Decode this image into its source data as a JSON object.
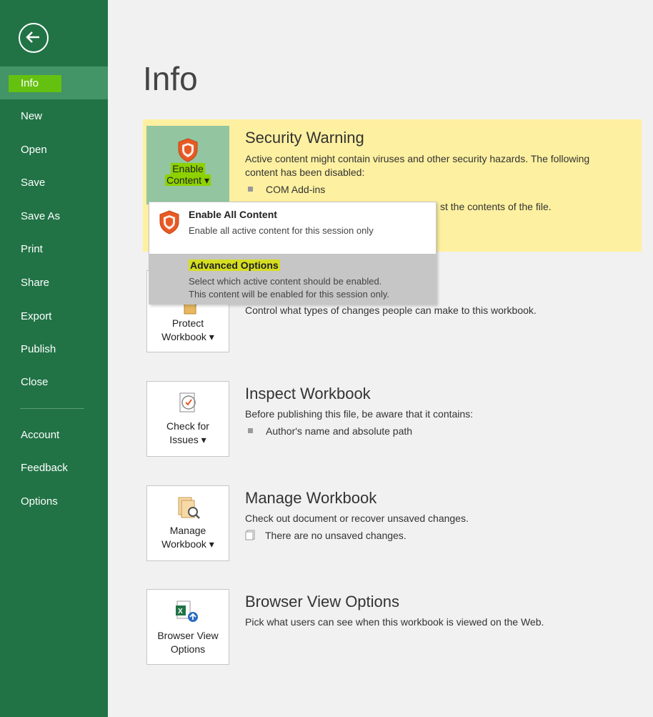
{
  "sidebar": {
    "items": [
      {
        "label": "Info"
      },
      {
        "label": "New"
      },
      {
        "label": "Open"
      },
      {
        "label": "Save"
      },
      {
        "label": "Save As"
      },
      {
        "label": "Print"
      },
      {
        "label": "Share"
      },
      {
        "label": "Export"
      },
      {
        "label": "Publish"
      },
      {
        "label": "Close"
      },
      {
        "label": "Account"
      },
      {
        "label": "Feedback"
      },
      {
        "label": "Options"
      }
    ]
  },
  "page": {
    "title": "Info"
  },
  "security": {
    "button_line1": "Enable",
    "button_line2": "Content",
    "title": "Security Warning",
    "desc1": "Active content might contain viruses and other security hazards. The following",
    "desc2": "content has been disabled:",
    "bullet": "COM Add-ins",
    "trust_text": "st the contents of the file."
  },
  "dropdown": {
    "enable_all_title": "Enable All Content",
    "enable_all_desc": "Enable all active content for this session only",
    "advanced_title": "Advanced Options",
    "advanced_desc1": "Select which active content should be enabled.",
    "advanced_desc2": "This content will be enabled for this session only."
  },
  "protect": {
    "button_line1": "Protect",
    "button_line2": "Workbook",
    "desc": "Control what types of changes people can make to this workbook."
  },
  "inspect": {
    "button_line1": "Check for",
    "button_line2": "Issues",
    "title": "Inspect Workbook",
    "desc": "Before publishing this file, be aware that it contains:",
    "bullet": "Author's name and absolute path"
  },
  "manage": {
    "button_line1": "Manage",
    "button_line2": "Workbook",
    "title": "Manage Workbook",
    "desc": "Check out document or recover unsaved changes.",
    "bullet": "There are no unsaved changes."
  },
  "browser": {
    "button_line1": "Browser View",
    "button_line2": "Options",
    "title": "Browser View Options",
    "desc": "Pick what users can see when this workbook is viewed on the Web."
  },
  "colors": {
    "sidebar": "#217346",
    "active": "#439467",
    "warning_band": "#fdf0a0",
    "highlight": "#d6de20"
  }
}
